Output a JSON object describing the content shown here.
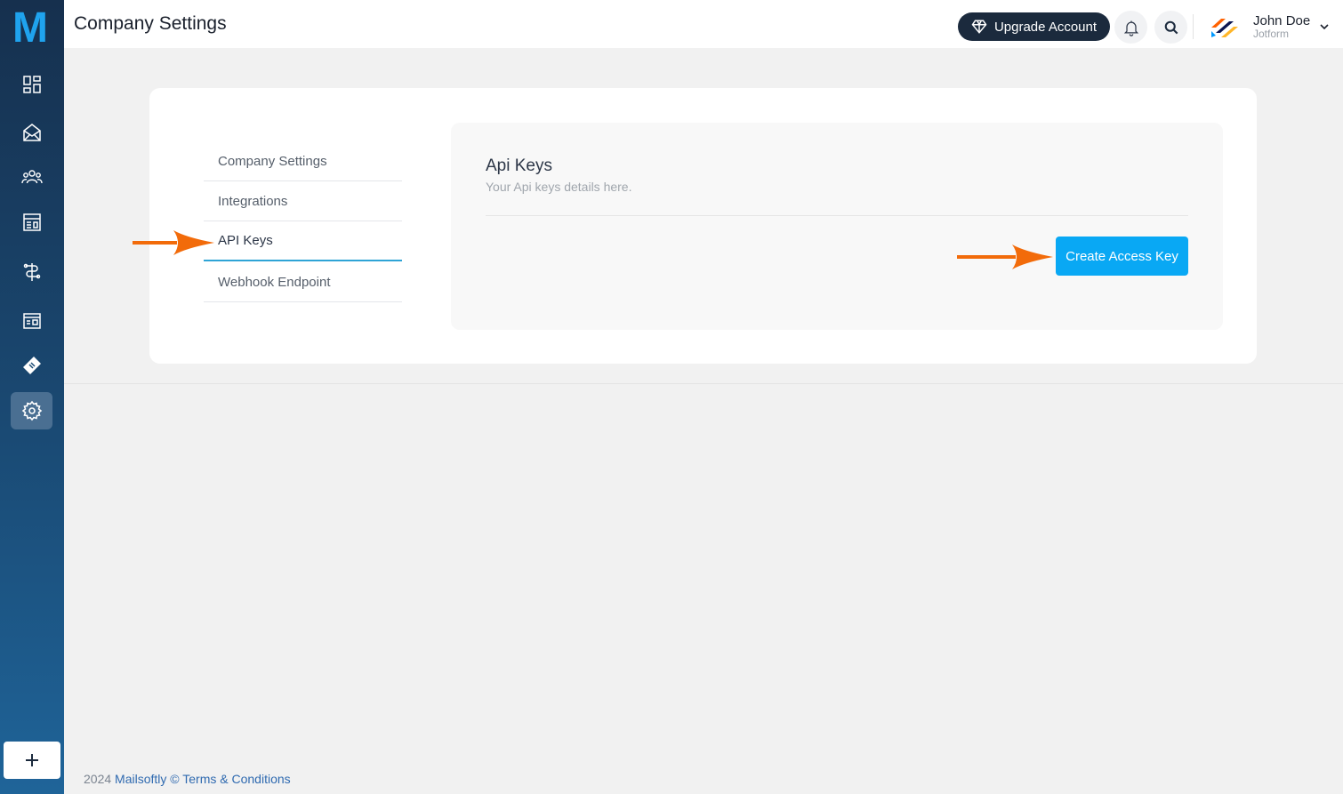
{
  "app": {
    "logo_letter": "M"
  },
  "header": {
    "title": "Company Settings",
    "upgrade_label": "Upgrade Account",
    "user": {
      "name": "John Doe",
      "org": "Jotform"
    }
  },
  "sidebar": {
    "items": [
      {
        "icon": "dashboard-icon"
      },
      {
        "icon": "campaign-mail-icon"
      },
      {
        "icon": "contacts-group-icon"
      },
      {
        "icon": "templates-icon"
      },
      {
        "icon": "automation-icon"
      },
      {
        "icon": "forms-icon"
      },
      {
        "icon": "tickets-icon"
      },
      {
        "icon": "settings-gear-icon",
        "active": true
      }
    ],
    "add_icon": "plus-icon"
  },
  "settings_nav": {
    "items": [
      {
        "label": "Company Settings"
      },
      {
        "label": "Integrations"
      },
      {
        "label": "API Keys",
        "active": true
      },
      {
        "label": "Webhook Endpoint"
      }
    ]
  },
  "panel": {
    "title": "Api Keys",
    "subtitle": "Your Api keys details here.",
    "create_button": "Create Access Key"
  },
  "footer": {
    "year": "2024",
    "brand": "Mailsoftly",
    "sep": "©",
    "terms": "Terms & Conditions"
  },
  "colors": {
    "accent": "#09a8f4",
    "annotation_arrow": "#f26b0a",
    "sidebar_top": "#16304e",
    "sidebar_bottom": "#1f6499"
  }
}
